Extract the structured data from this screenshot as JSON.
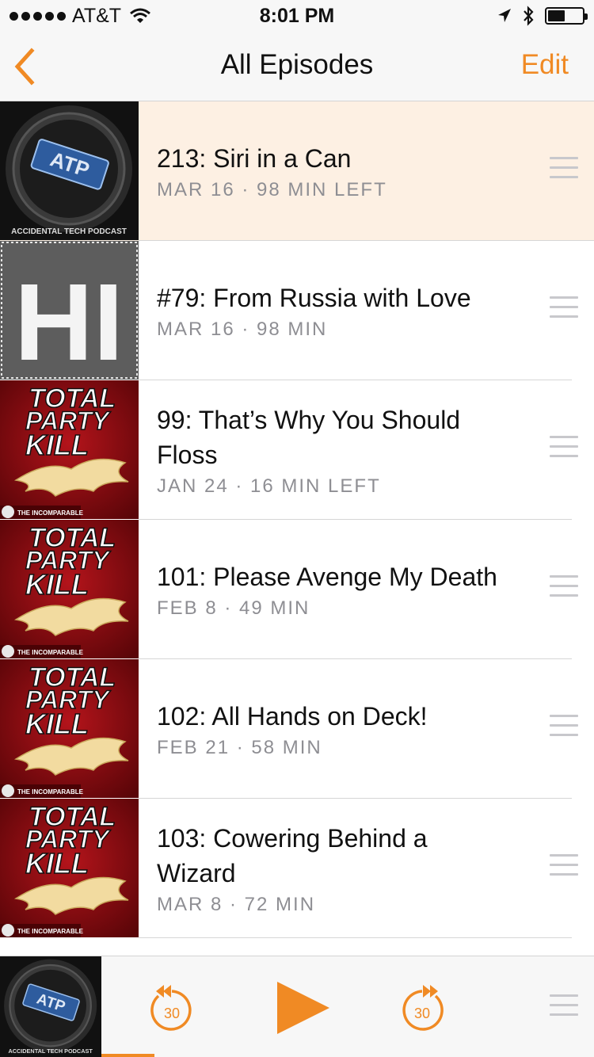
{
  "status_bar": {
    "carrier": "AT&T",
    "time": "8:01 PM",
    "battery_level": 0.5
  },
  "nav": {
    "title": "All Episodes",
    "edit_label": "Edit",
    "accent_color": "#f08a24"
  },
  "artwork": {
    "atp": {
      "badge": "ATP",
      "caption": "ACCIDENTAL TECH PODCAST"
    },
    "hi": {
      "letters": "HI"
    },
    "tpk": {
      "line1": "TOTAL",
      "line2": "PARTY",
      "line3": "KILL",
      "publisher": "THE INCOMPARABLE"
    }
  },
  "episodes": [
    {
      "title": "213: Siri in a Can",
      "meta": "MAR 16 · 98 MIN LEFT",
      "art": "atp",
      "active": true
    },
    {
      "title": "#79: From Russia with Love",
      "meta": "MAR 16 · 98 MIN",
      "art": "hi",
      "active": false
    },
    {
      "title": "99: That’s Why You Should Floss",
      "meta": "JAN 24 · 16 MIN LEFT",
      "art": "tpk",
      "active": false
    },
    {
      "title": "101: Please Avenge My Death",
      "meta": "FEB 8 · 49 MIN",
      "art": "tpk",
      "active": false
    },
    {
      "title": "102: All Hands on Deck!",
      "meta": "FEB 21 · 58 MIN",
      "art": "tpk",
      "active": false
    },
    {
      "title": "103: Cowering Behind a Wizard",
      "meta": "MAR 8 · 72 MIN",
      "art": "tpk",
      "active": false
    }
  ],
  "player": {
    "skip_back_label": "30",
    "skip_forward_label": "30",
    "progress_fraction": 0.26,
    "art": "atp"
  }
}
